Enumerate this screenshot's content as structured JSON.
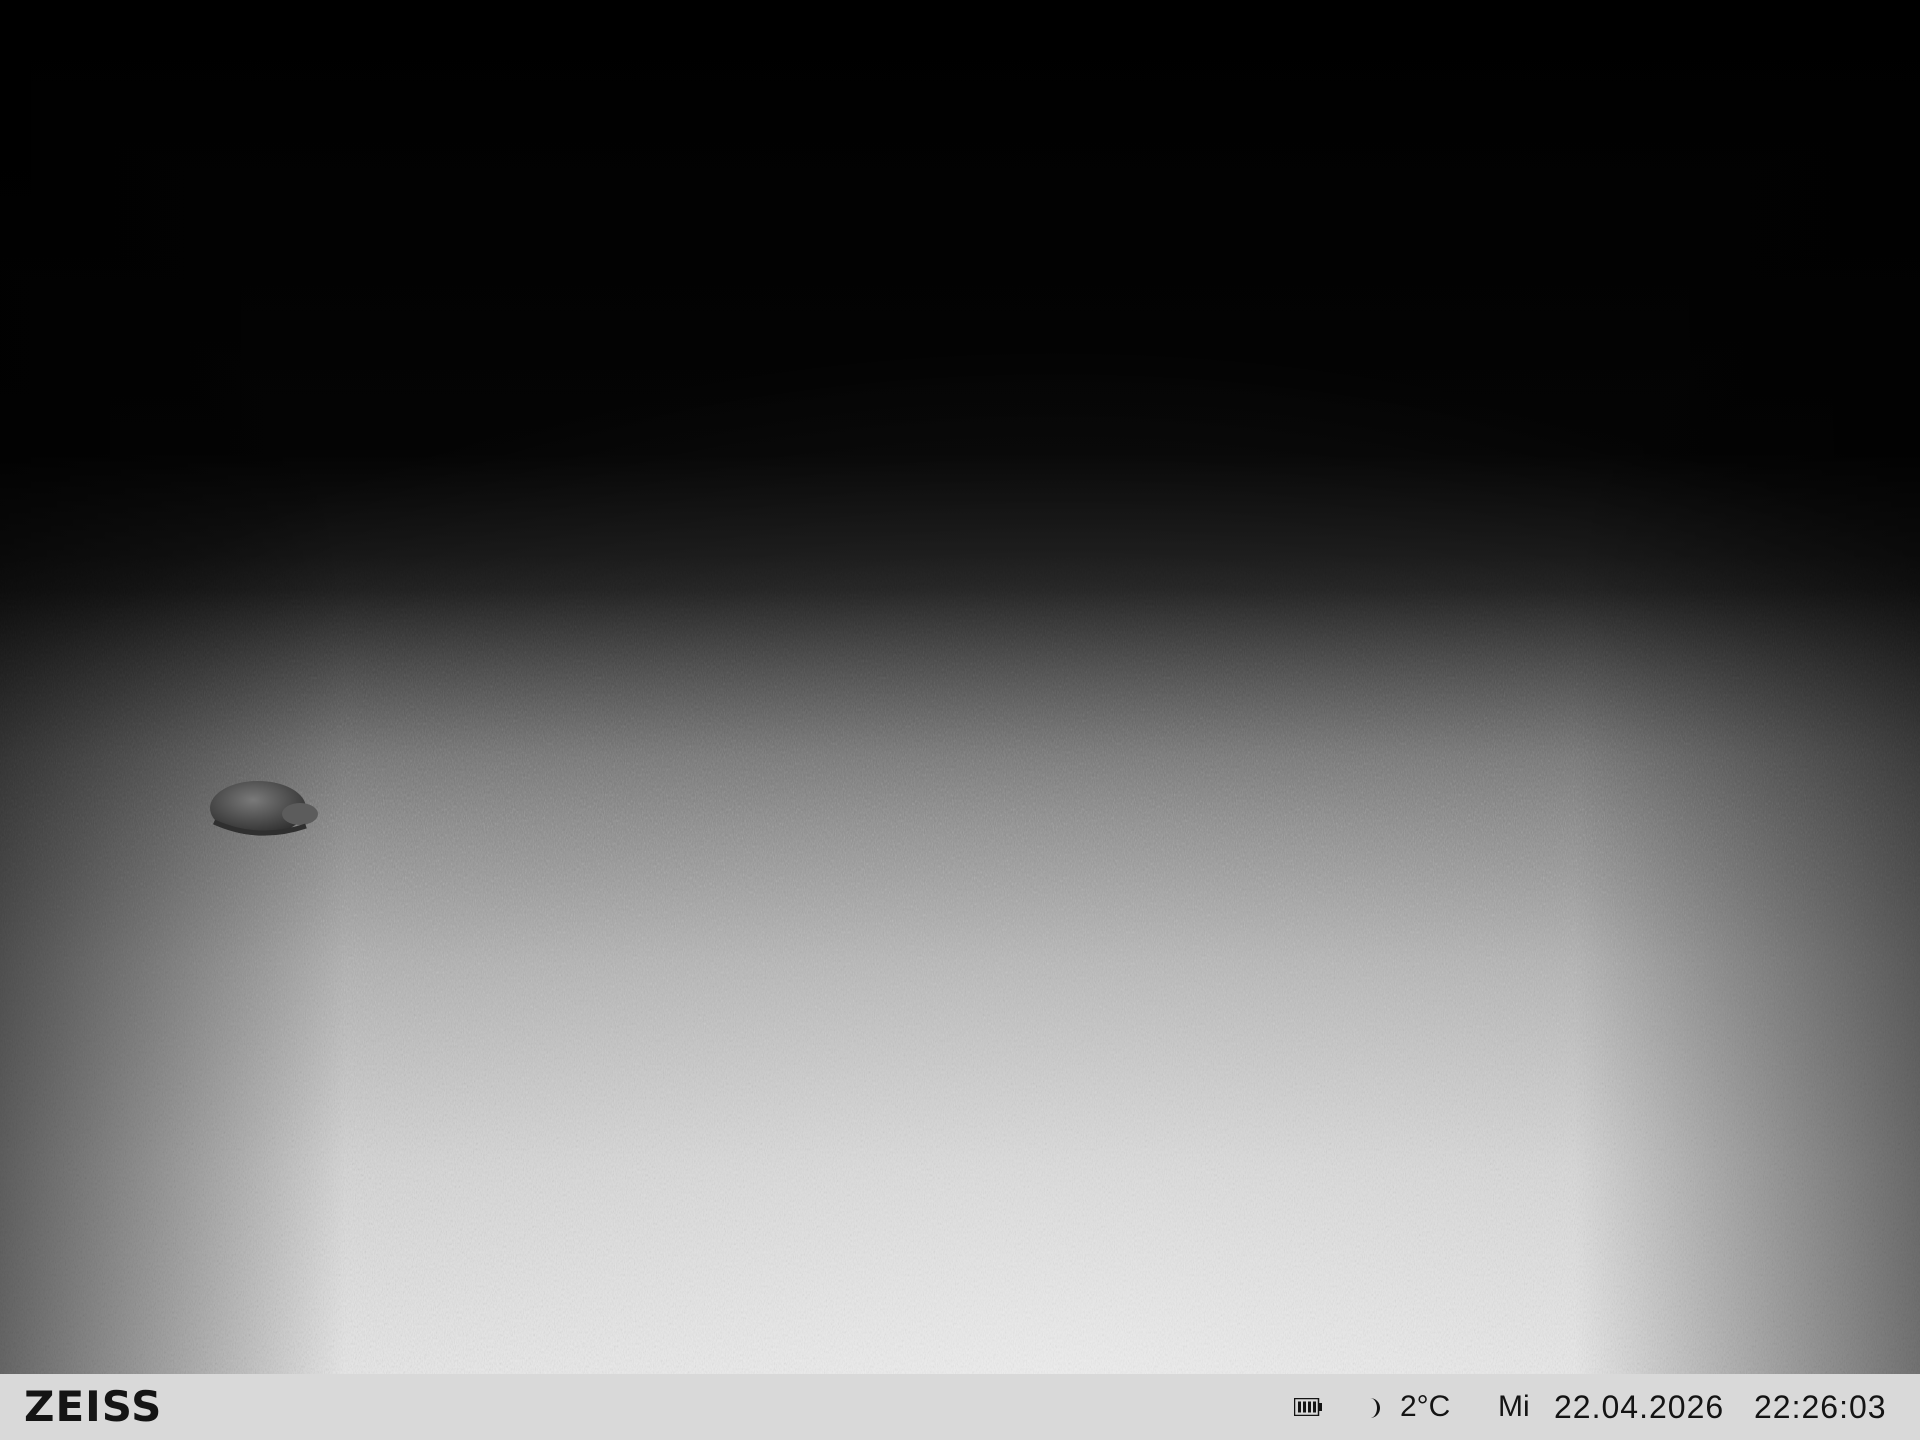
{
  "scene": {
    "subject": "badger"
  },
  "info_bar": {
    "brand": "ZEISS",
    "battery_icon": "battery-icon",
    "moon_icon": "moon-phase-icon",
    "temperature": "2°C",
    "weekday": "Mi",
    "date": "22.04.2026",
    "time": "22:26:03"
  },
  "colors": {
    "bar_background": "#d9d9d9",
    "bar_text": "#141414",
    "night_sky": "#000000",
    "ground_lit": "#dcdcdc"
  }
}
